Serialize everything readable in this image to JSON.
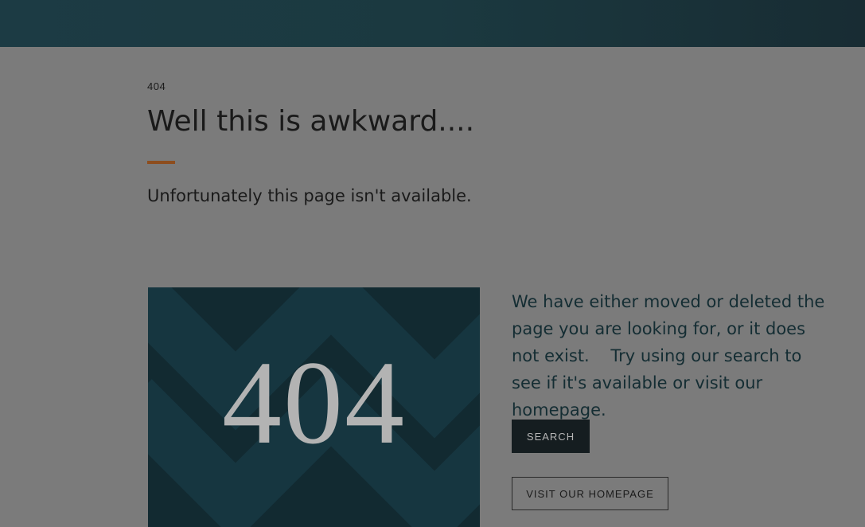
{
  "header": {
    "background_color": "#1b3940"
  },
  "error": {
    "code_label": "404",
    "title": "Well this is awkward....",
    "subtitle": "Unfortunately this page isn't available.",
    "accent_color": "#8d4d1e"
  },
  "hero": {
    "text": "404",
    "background_color": "#122a31"
  },
  "message": {
    "text": "We have either moved or deleted the page you are looking for, or it does not exist.    Try using our search to see if it's available or visit our homepage."
  },
  "buttons": {
    "search_label": "SEARCH",
    "homepage_label": "VISIT OUR HOMEPAGE"
  }
}
